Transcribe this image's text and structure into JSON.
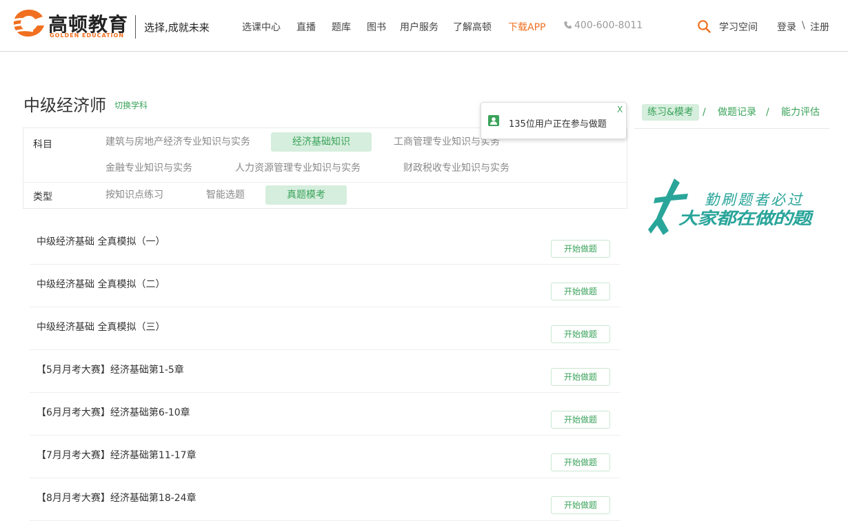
{
  "header": {
    "logo_cn": "高顿教育",
    "logo_en": "GOLDEN EDUCATION",
    "slogan": "选择,成就未来",
    "nav": [
      {
        "label": "选课中心"
      },
      {
        "label": "直播"
      },
      {
        "label": "题库"
      },
      {
        "label": "图书"
      },
      {
        "label": "用户服务"
      },
      {
        "label": "了解高顿"
      },
      {
        "label": "下载APP"
      }
    ],
    "phone": "400-600-8011",
    "study_space": "学习空间",
    "login": "登录",
    "sep": "\\",
    "register": "注册"
  },
  "page": {
    "title": "中级经济师",
    "switch_subject": "切换学科"
  },
  "right_tabs": [
    {
      "label": "练习&模考",
      "active": true
    },
    {
      "label": "做题记录",
      "active": false
    },
    {
      "label": "能力评估",
      "active": false
    }
  ],
  "tab_separator": "/",
  "filter": {
    "subject_label": "科目",
    "subjects": [
      {
        "label": "建筑与房地产经济专业知识与实务",
        "active": false
      },
      {
        "label": "经济基础知识",
        "active": true
      },
      {
        "label": "工商管理专业知识与实务",
        "active": false
      },
      {
        "label": "金融专业知识与实务",
        "active": false
      },
      {
        "label": "人力资源管理专业知识与实务",
        "active": false
      },
      {
        "label": "财政税收专业知识与实务",
        "active": false
      }
    ],
    "type_label": "类型",
    "types": [
      {
        "label": "按知识点练习",
        "active": false
      },
      {
        "label": "智能选题",
        "active": false
      },
      {
        "label": "真题模考",
        "active": true
      }
    ]
  },
  "tooltip": {
    "text": "135位用户正在参与做题",
    "close": "X"
  },
  "promo": {
    "line1": "勤刷题者必过",
    "line2": "大家都在做的题"
  },
  "list": {
    "button_label": "开始做题",
    "items": [
      {
        "title": "中级经济基础 全真模拟（一）"
      },
      {
        "title": "中级经济基础 全真模拟（二）"
      },
      {
        "title": "中级经济基础 全真模拟（三）"
      },
      {
        "title": "【5月月考大赛】经济基础第1-5章"
      },
      {
        "title": "【6月月考大赛】经济基础第6-10章"
      },
      {
        "title": "【7月月考大赛】经济基础第11-17章"
      },
      {
        "title": "【8月月考大赛】经济基础第18-24章"
      }
    ]
  },
  "colors": {
    "brand_orange": "#f07020",
    "accent_green": "#3aa35a",
    "active_bg": "#d6eedd",
    "promo_teal": "#2aa59a"
  },
  "icons": {
    "logo": "golden-education-logo-mark",
    "phone": "phone-icon",
    "search": "search-icon",
    "user": "user-icon"
  }
}
